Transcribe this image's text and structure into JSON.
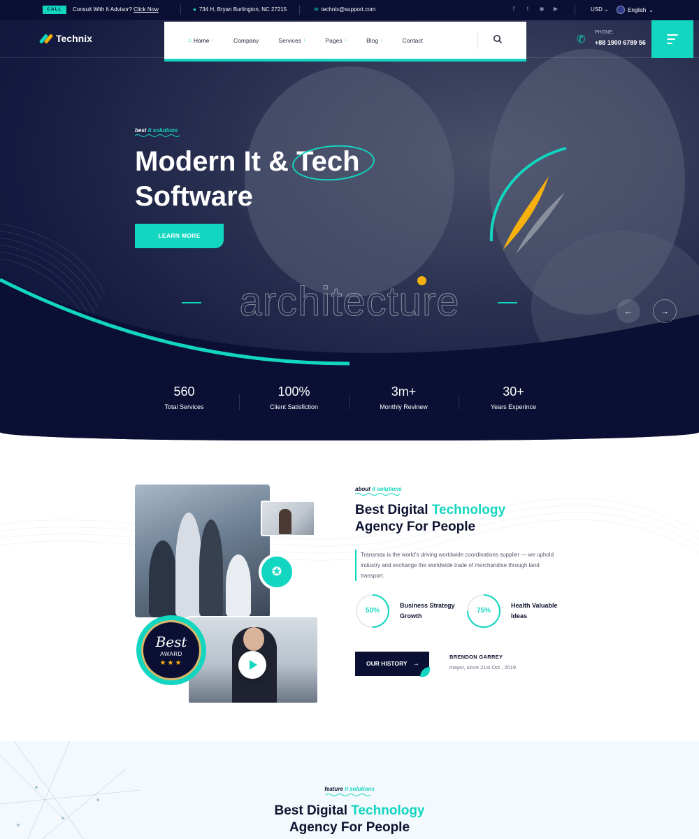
{
  "topbar": {
    "call_badge": "CALL",
    "consult_text": "Consult With It Advisor?",
    "consult_link": "Click Now",
    "address": "734 H, Bryan Burlington, NC 27215",
    "email": "technix@support.com",
    "social_icons": [
      "facebook-icon",
      "twitter-icon",
      "instagram-icon",
      "youtube-icon"
    ],
    "currency": "USD",
    "language": "English"
  },
  "header": {
    "logo_text": "Technix",
    "nav": [
      {
        "label": "Home",
        "has_caret": true
      },
      {
        "label": "Company",
        "has_caret": false
      },
      {
        "label": "Services",
        "has_caret": true
      },
      {
        "label": "Pages",
        "has_caret": true
      },
      {
        "label": "Blog",
        "has_caret": true
      },
      {
        "label": "Contact",
        "has_caret": false
      }
    ],
    "phone_label": "PHONE:",
    "phone_number": "+88 1900 6789 56"
  },
  "hero": {
    "tag_prefix": "best",
    "tag_highlight": "it solutions",
    "title_line1_a": "Modern It &",
    "title_line1_b": "Tech",
    "title_line2": "Software",
    "cta_label": "LEARN MORE",
    "watermark_word": "architecture",
    "prev_icon": "arrow-left-icon",
    "next_icon": "arrow-right-icon"
  },
  "stats": [
    {
      "value": "560",
      "label": "Total Services"
    },
    {
      "value": "100%",
      "label": "Client Satisfiction"
    },
    {
      "value": "3m+",
      "label": "Monthly Revinew"
    },
    {
      "value": "30+",
      "label": "Years Experince"
    }
  ],
  "about": {
    "tag_prefix": "about",
    "tag_highlight": "it solutions",
    "title_a": "Best Digital",
    "title_b": "Technology",
    "title_line2": "Agency For People",
    "description": "Transmax is the world's driving worldwide coordinations supplier — we uphold industry and exchange the worldwide trade of merchandise through land transport.",
    "progress": [
      {
        "value": 50,
        "text": "50%",
        "label": "Business Strategy Growth"
      },
      {
        "value": 75,
        "text": "75%",
        "label": "Health Valuable Ideas"
      }
    ],
    "button_label": "OUR HISTORY",
    "signature_name": "BRENDON GARREY",
    "signature_role": "mayor, since 21st Oct , 2019",
    "badge_title": "Best",
    "badge_sub": "AWARD",
    "badge_stars": "★★★"
  },
  "feature": {
    "tag_prefix": "feature",
    "tag_highlight": "it solutions",
    "title_a": "Best Digital",
    "title_b": "Technology",
    "title_line2": "Agency For People"
  },
  "colors": {
    "accent": "#12d6c0",
    "navy": "#0b0f33",
    "orange": "#f6b10f"
  }
}
